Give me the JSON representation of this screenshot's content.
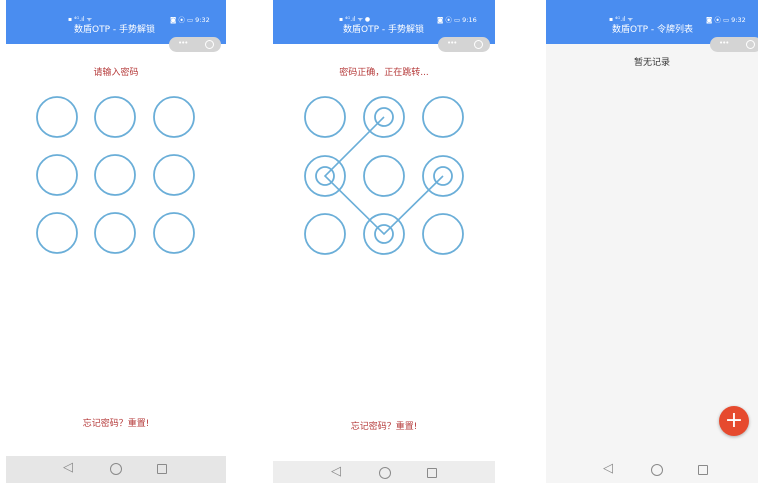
{
  "screens": [
    {
      "status_left": "▪ ⁴ᴳ.ıl ᯤ",
      "status_right": "◙ ⦿ ▭ 9:32",
      "title": "数盾OTP - 手势解锁",
      "prompt": "请输入密码",
      "forgot": "忘记密码？重置!"
    },
    {
      "status_left": "▪ ⁴ᴳ.ıl ᯤ ●",
      "status_right": "◙ ⦿ ▭ 9:16",
      "title": "数盾OTP - 手势解锁",
      "prompt": "密码正确，正在跳转...",
      "forgot": "忘记密码？重置!",
      "pattern_path": [
        1,
        3,
        7,
        5
      ]
    },
    {
      "status_left": "▪ ⁴ᴳ.ıl ᯤ",
      "status_right": "◙ ⦿ ▭ 9:32",
      "title": "数盾OTP - 令牌列表",
      "empty": "暂无记录",
      "fab": "+"
    }
  ],
  "capsule": {
    "dots": "•••",
    "icon": "record-icon"
  },
  "nav": {
    "back": "◁",
    "icons": [
      "back-icon",
      "home-icon",
      "recents-icon"
    ]
  },
  "colors": {
    "statusbar": "#4a8df0",
    "circle": "#6aaed8",
    "prompt": "#b53a3a",
    "fab": "#e64a2e"
  }
}
